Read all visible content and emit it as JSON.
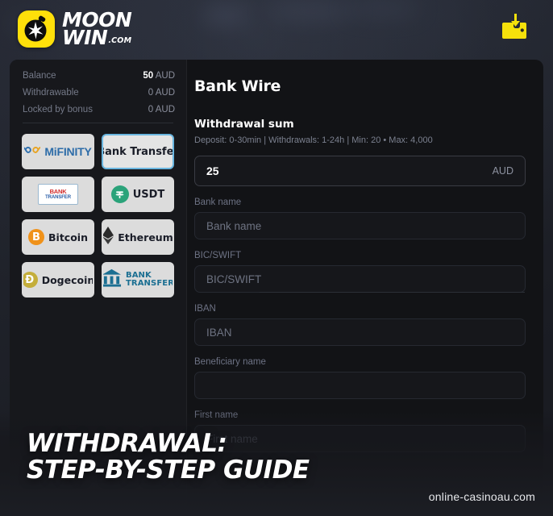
{
  "brand": {
    "logo_icon": "bomb-star-logo-icon",
    "name_line1": "MOON",
    "name_line2": "WIN",
    "name_suffix": ".COM"
  },
  "header": {
    "wallet_icon": "wallet-deposit-icon"
  },
  "sidebar": {
    "balances": [
      {
        "label": "Balance",
        "amount": "50",
        "currency": "AUD",
        "bold": true
      },
      {
        "label": "Withdrawable",
        "amount": "0",
        "currency": "AUD",
        "bold": false
      },
      {
        "label": "Locked by bonus",
        "amount": "0",
        "currency": "AUD",
        "bold": false
      }
    ],
    "methods": [
      {
        "label": "MiFINITY",
        "icon": "mifinity-logo-icon",
        "selected": false
      },
      {
        "label": "Bank Transfer",
        "icon": "bank-transfer-text-icon",
        "selected": true
      },
      {
        "label": "BANK TRANSFER",
        "icon": "bank-transfer-card-icon",
        "selected": false
      },
      {
        "label": "USDT",
        "icon": "tether-usdt-icon",
        "selected": false
      },
      {
        "label": "Bitcoin",
        "icon": "bitcoin-icon",
        "selected": false
      },
      {
        "label": "Ethereum",
        "icon": "ethereum-icon",
        "selected": false
      },
      {
        "label": "Dogecoin",
        "icon": "dogecoin-icon",
        "selected": false
      },
      {
        "label": "BANK TRANSFER",
        "icon": "bank-building-icon",
        "selected": false
      }
    ],
    "card_icon_line1": "BANK",
    "card_icon_line2": "TRANSFER",
    "bank_icon_line1": "BANK",
    "bank_icon_line2": "TRANSFER"
  },
  "main": {
    "title": "Bank Wire",
    "withdrawal_sum_label": "Withdrawal sum",
    "limits_note": "Deposit: 0-30min | Withdrawals: 1-24h | Min: 20 • Max: 4,000",
    "amount_value": "25",
    "amount_currency": "AUD",
    "fields": [
      {
        "label": "Bank name",
        "value": "",
        "placeholder": "Bank name"
      },
      {
        "label": "BIC/SWIFT",
        "value": "",
        "placeholder": "BIC/SWIFT"
      },
      {
        "label": "IBAN",
        "value": "",
        "placeholder": "IBAN"
      },
      {
        "label": "Beneficiary name",
        "value": "",
        "placeholder": ""
      },
      {
        "label": "First name",
        "value": "",
        "placeholder": "First name"
      }
    ]
  },
  "overlay": {
    "headline_line1": "WITHDRAWAL:",
    "headline_line2": "STEP-BY-STEP GUIDE",
    "watermark": "online-casinoau.com"
  },
  "colors": {
    "brand_yellow": "#ffe00a",
    "selected_border": "#6ab6e0",
    "modal_bg": "#121316",
    "sidebar_bg": "#17181c",
    "tile_bg": "#dcdcdc"
  }
}
